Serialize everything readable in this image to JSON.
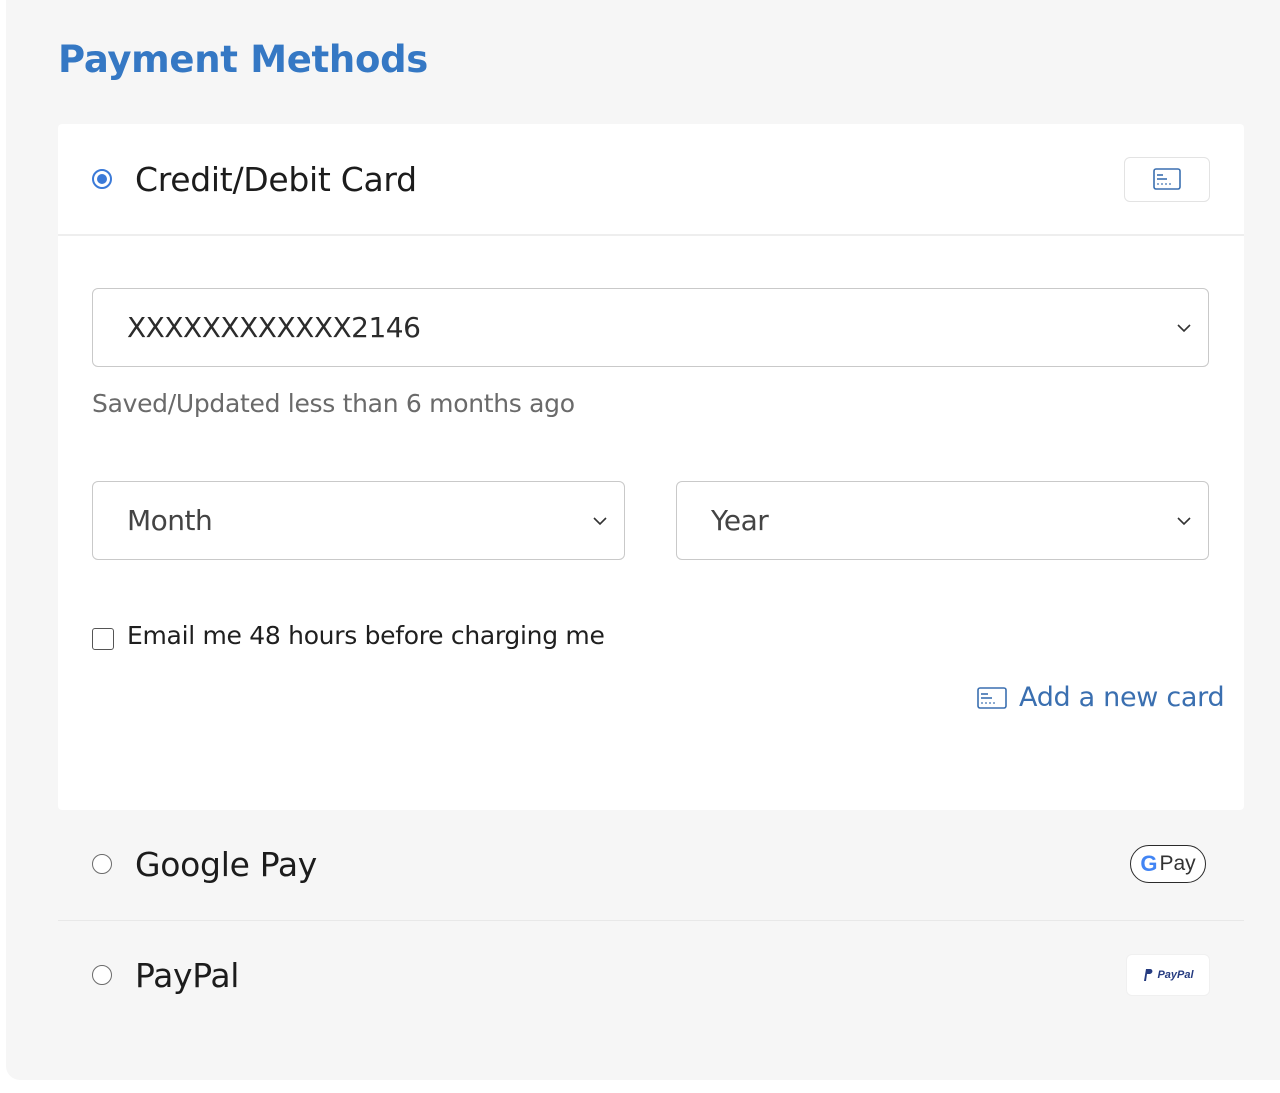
{
  "page": {
    "title": "Payment Methods"
  },
  "methods": {
    "card": {
      "label": "Credit/Debit Card",
      "selected": true,
      "icon": "credit-card-icon",
      "card_number": "XXXXXXXXXXXX2146",
      "saved_hint": "Saved/Updated less than 6 months ago",
      "month_placeholder": "Month",
      "year_placeholder": "Year",
      "email_checkbox_label": "Email me 48 hours before charging me",
      "email_checkbox_checked": false,
      "add_card_label": "Add a new card"
    },
    "google_pay": {
      "label": "Google Pay",
      "selected": false,
      "logo_g": "G",
      "logo_text": "Pay"
    },
    "paypal": {
      "label": "PayPal",
      "selected": false,
      "logo_text": "PayPal"
    }
  },
  "colors": {
    "accent": "#3578c4",
    "radio_selected": "#3b7ad8",
    "link": "#3a6fb0"
  }
}
